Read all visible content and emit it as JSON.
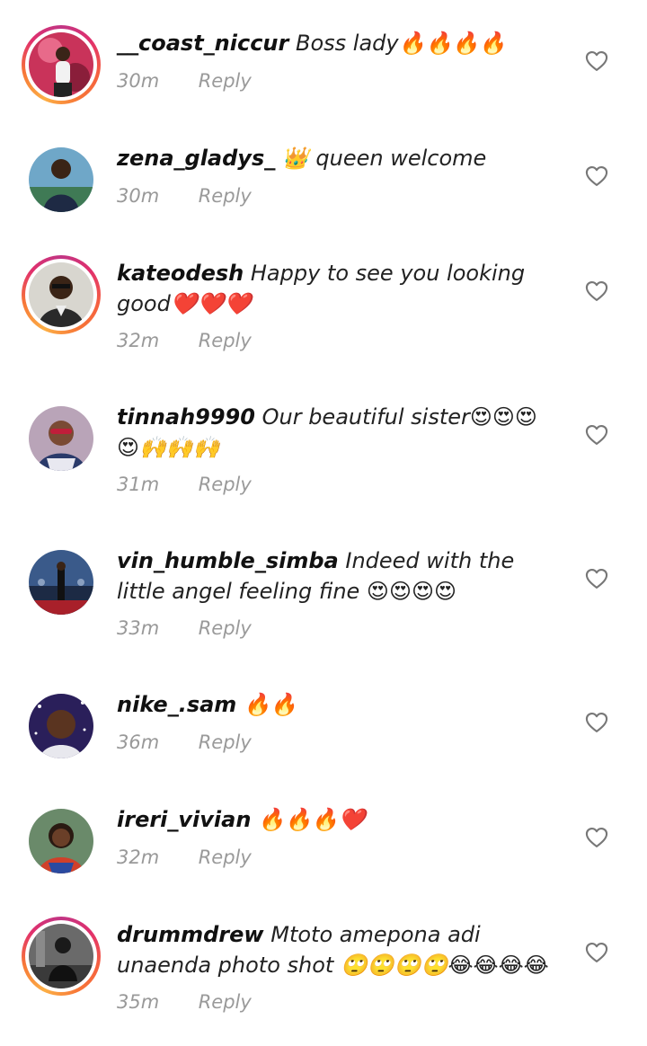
{
  "reply_label": "Reply",
  "comments": [
    {
      "username": "__coast_niccur",
      "text": "Boss lady🔥🔥🔥🔥",
      "time": "30m"
    },
    {
      "username": "zena_gladys_",
      "text": "👑 queen welcome",
      "time": "30m"
    },
    {
      "username": "kateodesh",
      "text": "Happy to see you looking good❤️❤️❤️",
      "time": "32m"
    },
    {
      "username": "tinnah9990",
      "text": "Our beautiful sister😍😍😍😍🙌🙌🙌",
      "time": "31m"
    },
    {
      "username": "vin_humble_simba",
      "text": "Indeed with the little angel feeling fine 😍😍😍😍",
      "time": "33m"
    },
    {
      "username": "nike_.sam",
      "text": "🔥🔥",
      "time": "36m"
    },
    {
      "username": "ireri_vivian",
      "text": "🔥🔥🔥❤️",
      "time": "32m"
    },
    {
      "username": "drummdrew",
      "text": "Mtoto amepona adi unaenda photo shot 🙄🙄🙄🙄😂😂😂😂",
      "time": "35m"
    }
  ]
}
